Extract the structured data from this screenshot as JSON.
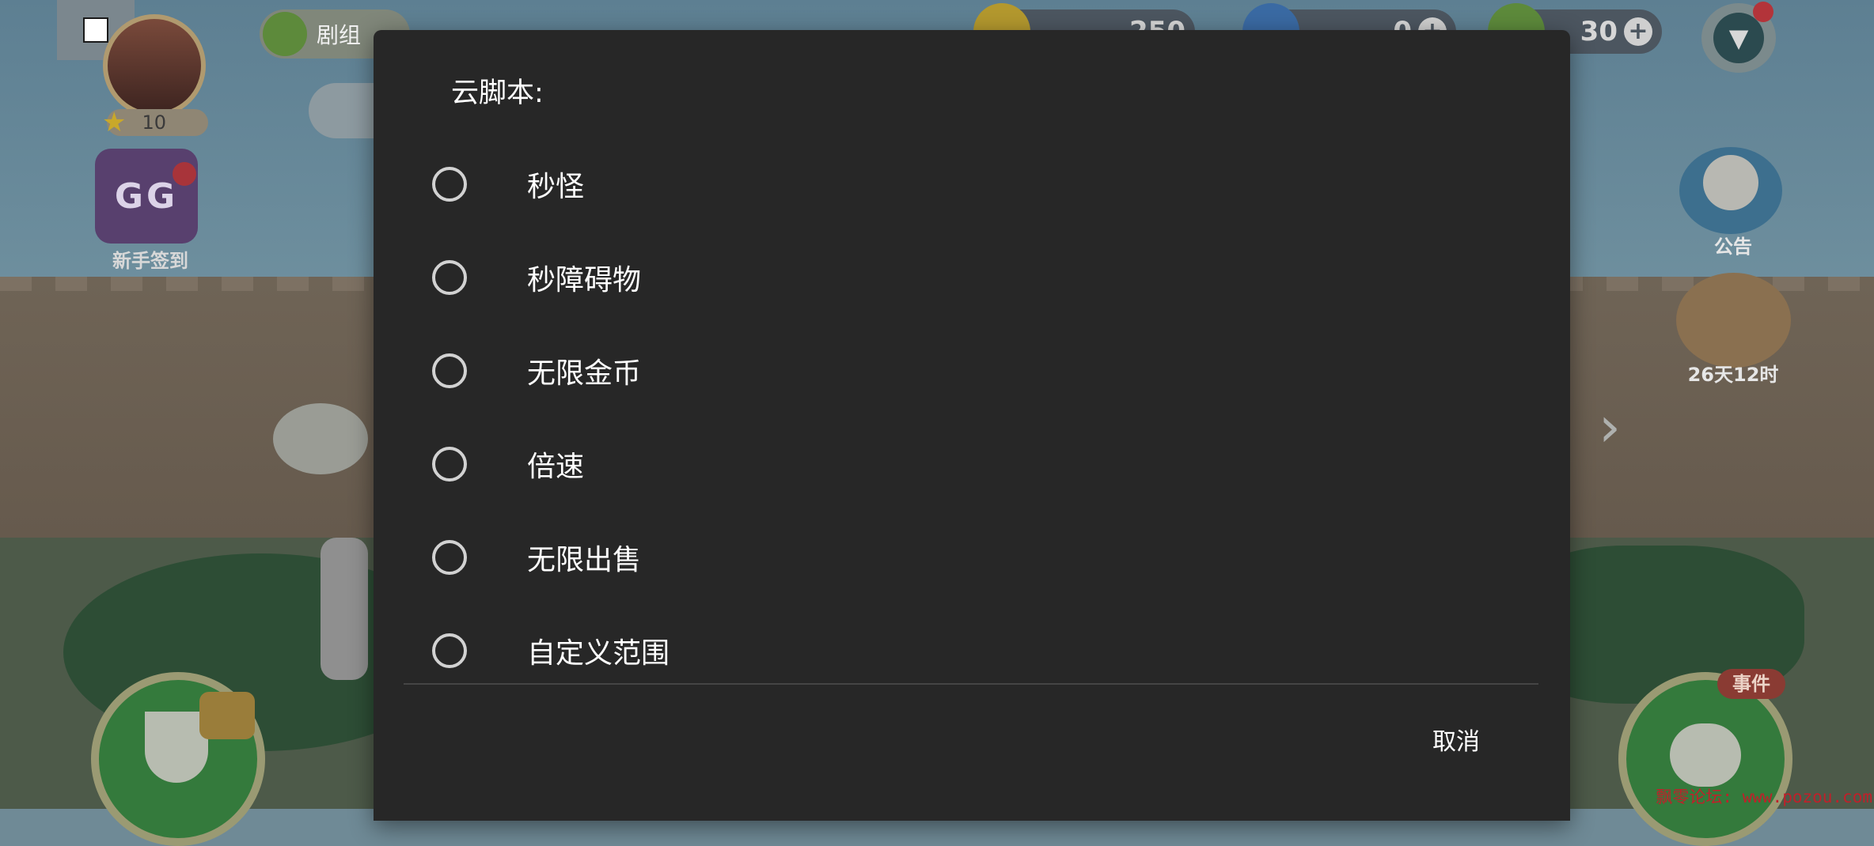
{
  "game": {
    "player_level": "10",
    "story_button_label": "剧组",
    "signin_label": "新手签到",
    "gg_icon_text": "GG",
    "currencies": {
      "coins": "250",
      "gems": "0",
      "leaves": "30"
    },
    "notice_label": "公告",
    "event_timer": "26天12时",
    "event_badge": "事件",
    "watermark": "飘零论坛: www.pozou.com"
  },
  "dialog": {
    "title": "云脚本:",
    "options": [
      {
        "label": "秒怪",
        "selected": false
      },
      {
        "label": "秒障碍物",
        "selected": false
      },
      {
        "label": "无限金币",
        "selected": false
      },
      {
        "label": "倍速",
        "selected": false
      },
      {
        "label": "无限出售",
        "selected": false
      },
      {
        "label": "自定义范围",
        "selected": false
      }
    ],
    "cancel_label": "取消"
  },
  "icons": {
    "menu": "chevron-down-icon",
    "plus": "plus-icon",
    "chevron": "chevron-right-icon"
  }
}
